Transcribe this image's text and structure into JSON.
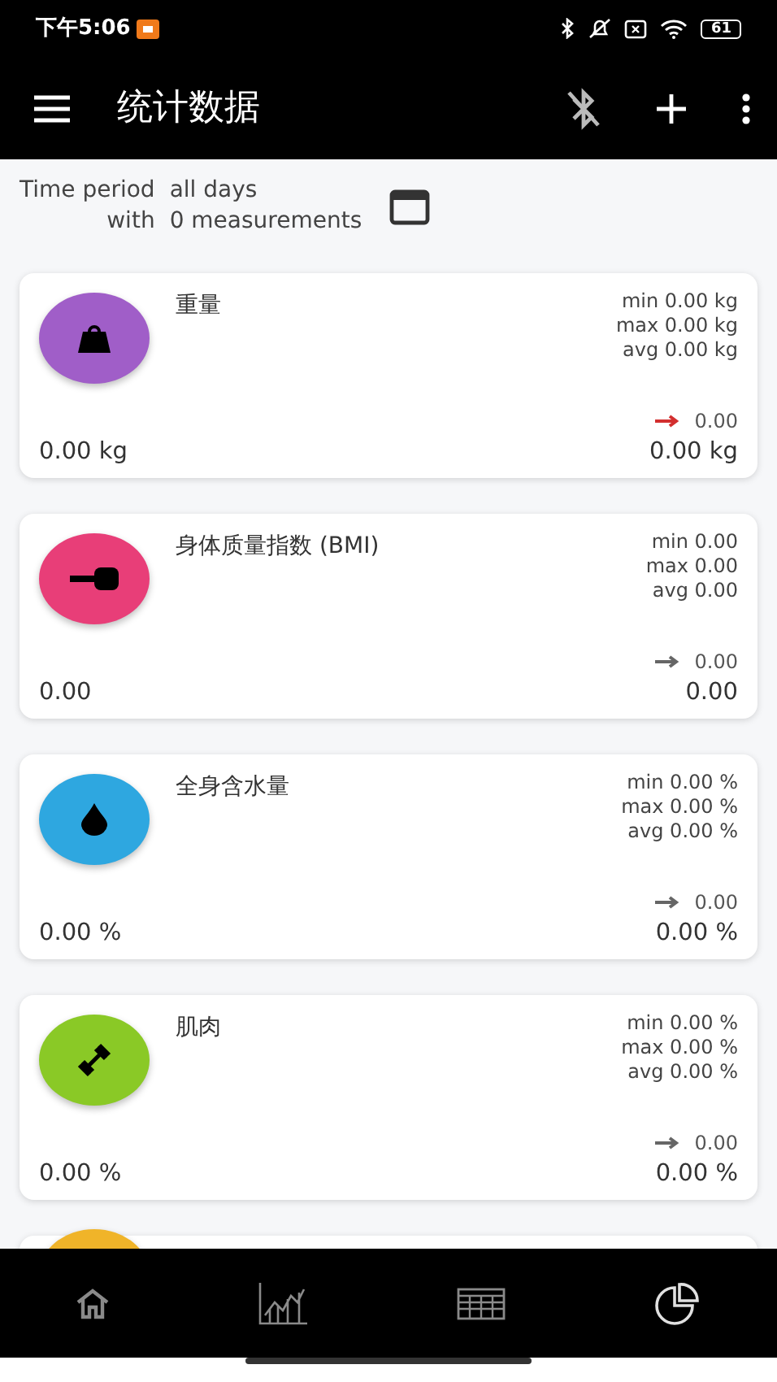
{
  "status_bar": {
    "time": "下午5:06",
    "battery": "61"
  },
  "app_bar": {
    "title": "统计数据"
  },
  "period": {
    "label": "Time period",
    "value": "all days",
    "with_label": "with",
    "count": "0 measurements"
  },
  "cards": [
    {
      "kind": "weight",
      "color": "#a05ec8",
      "name": "重量",
      "min": "min 0.00 kg",
      "max": "max 0.00 kg",
      "avg": "avg 0.00 kg",
      "trend": {
        "value": "0.00",
        "color": "#d32f2f"
      },
      "first": "0.00 kg",
      "last": "0.00 kg"
    },
    {
      "kind": "bmi",
      "color": "#e83e78",
      "name": "身体质量指数 (BMI)",
      "min": "min 0.00",
      "max": "max 0.00",
      "avg": "avg 0.00",
      "trend": {
        "value": "0.00",
        "color": "#666666"
      },
      "first": "0.00",
      "last": "0.00"
    },
    {
      "kind": "water",
      "color": "#2ea7e0",
      "name": "全身含水量",
      "min": "min 0.00 %",
      "max": "max 0.00 %",
      "avg": "avg 0.00 %",
      "trend": {
        "value": "0.00",
        "color": "#666666"
      },
      "first": "0.00 %",
      "last": "0.00 %"
    },
    {
      "kind": "muscle",
      "color": "#8ac926",
      "name": "肌肉",
      "min": "min 0.00 %",
      "max": "max 0.00 %",
      "avg": "avg 0.00 %",
      "trend": {
        "value": "0.00",
        "color": "#666666"
      },
      "first": "0.00 %",
      "last": "0.00 %"
    },
    {
      "kind": "partial",
      "color": "#f0b429"
    }
  ],
  "bottom_nav": [
    {
      "kind": "home",
      "selected": false
    },
    {
      "kind": "chart",
      "selected": false
    },
    {
      "kind": "table",
      "selected": false
    },
    {
      "kind": "pie",
      "selected": true
    }
  ]
}
